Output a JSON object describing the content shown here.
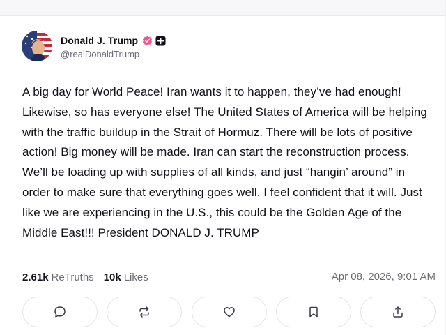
{
  "post": {
    "author_name": "Donald J. Trump",
    "handle": "@realDonaldTrump",
    "verified_badge_color": "#e8578f",
    "text": "A big day for World Peace! Iran wants it to happen, they’ve had enough! Likewise, so has everyone else! The United States of America will be helping with the traffic buildup in the Strait of Hormuz. There will be lots of positive action! Big money will be made. Iran can start the reconstruction process. We’ll be loading up with supplies of all kinds, and just “hangin’ around” in order to make sure that everything goes well. I feel confident that it will. Just like we are experiencing in the U.S., this could be the Golden Age of the Middle East!!! President DONALD J. TRUMP",
    "retruths_count": "2.61k",
    "retruths_label": "ReTruths",
    "likes_count": "10k",
    "likes_label": "Likes",
    "timestamp": "Apr 08, 2026, 9:01 AM"
  },
  "actions": [
    {
      "icon": "reply-icon"
    },
    {
      "icon": "retruth-icon"
    },
    {
      "icon": "like-heart-icon"
    },
    {
      "icon": "bookmark-icon"
    },
    {
      "icon": "share-icon"
    }
  ]
}
